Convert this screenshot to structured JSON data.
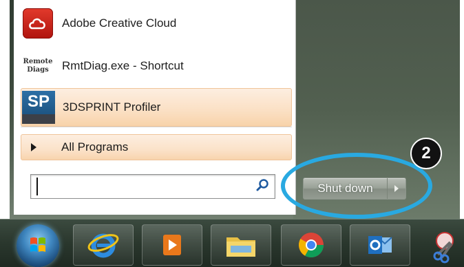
{
  "start_menu": {
    "programs": [
      {
        "label": "Adobe Creative Cloud",
        "icon": "adobe-creative-cloud-icon"
      },
      {
        "label": "RmtDiag.exe - Shortcut",
        "icon": "remote-diag-icon",
        "icon_text": [
          "Remote",
          "Diags"
        ]
      },
      {
        "label": "3DSPRINT Profiler",
        "icon": "sp-icon",
        "icon_text": "SP",
        "highlighted": true
      }
    ],
    "all_programs_label": "All Programs",
    "search": {
      "value": "",
      "placeholder": ""
    },
    "shutdown_label": "Shut down"
  },
  "callout": {
    "number": "2",
    "color": "#29a9e1"
  },
  "taskbar": {
    "icons": [
      "start-orb",
      "internet-explorer-icon",
      "media-player-icon",
      "file-explorer-icon",
      "chrome-icon",
      "outlook-icon",
      "snipping-tool-icon"
    ]
  },
  "colors": {
    "highlight": "#fbe1c6",
    "callout_ring": "#29a9e1",
    "taskbar": "#2a372d"
  }
}
